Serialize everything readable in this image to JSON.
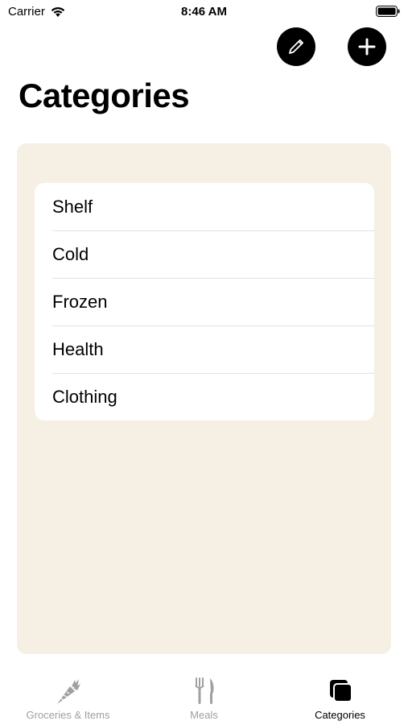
{
  "status_bar": {
    "carrier": "Carrier",
    "time": "8:46 AM"
  },
  "toolbar": {
    "edit_icon": "pencil-icon",
    "add_icon": "plus-icon"
  },
  "page": {
    "title": "Categories"
  },
  "categories": [
    {
      "label": "Shelf"
    },
    {
      "label": "Cold"
    },
    {
      "label": "Frozen"
    },
    {
      "label": "Health"
    },
    {
      "label": "Clothing"
    }
  ],
  "tabs": [
    {
      "label": "Groceries & Items",
      "icon": "carrot-icon",
      "active": false
    },
    {
      "label": "Meals",
      "icon": "fork-knife-icon",
      "active": false
    },
    {
      "label": "Categories",
      "icon": "stacked-squares-icon",
      "active": true
    }
  ],
  "colors": {
    "panel_background": "#f5efe4",
    "inactive_tab": "#a0a0a0",
    "active_tab": "#000000"
  }
}
